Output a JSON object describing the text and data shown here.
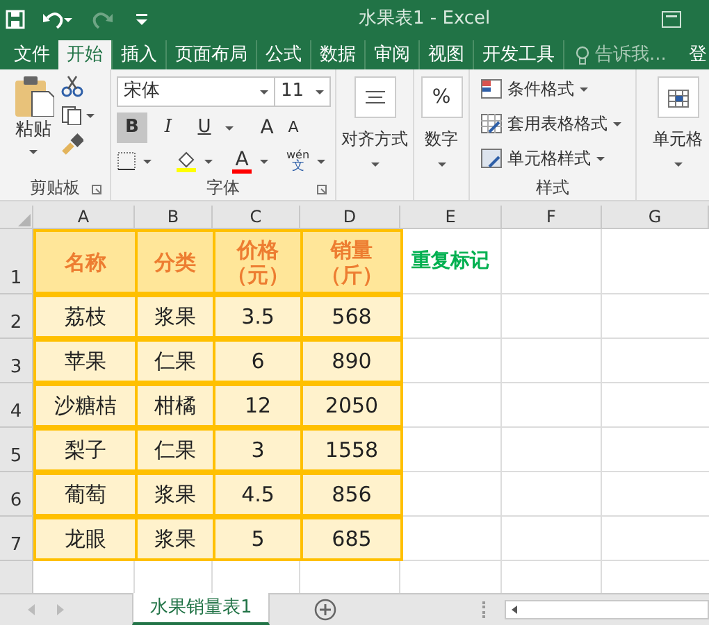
{
  "window": {
    "title": "水果表1 - Excel"
  },
  "tabs": [
    {
      "label": "文件",
      "selected": false
    },
    {
      "label": "开始",
      "selected": true
    },
    {
      "label": "插入",
      "selected": false
    },
    {
      "label": "页面布局",
      "selected": false
    },
    {
      "label": "公式",
      "selected": false
    },
    {
      "label": "数据",
      "selected": false
    },
    {
      "label": "审阅",
      "selected": false
    },
    {
      "label": "视图",
      "selected": false
    },
    {
      "label": "开发工具",
      "selected": false
    }
  ],
  "tell_me": {
    "placeholder": "告诉我..."
  },
  "account": "登",
  "ribbon": {
    "clipboard": {
      "paste": "粘贴",
      "label": "剪贴板"
    },
    "font": {
      "name": "宋体",
      "size": "11",
      "label": "字体",
      "format_buttons": [
        {
          "label": "B",
          "on": true
        },
        {
          "label": "I",
          "on": false
        },
        {
          "label": "U",
          "on": false
        }
      ],
      "grow": "A",
      "shrink": "A",
      "font_color": "A",
      "phonetic": {
        "top": "wén",
        "bottom": "文"
      }
    },
    "alignment": "对齐方式",
    "number": {
      "symbol": "%",
      "label": "数字"
    },
    "styles": {
      "items": [
        "条件格式",
        "套用表格格式",
        "单元格样式"
      ],
      "label": "样式"
    },
    "cells": "单元格"
  },
  "sheet": {
    "columns": [
      "A",
      "B",
      "C",
      "D",
      "E",
      "F",
      "G"
    ],
    "rows": [
      {
        "number": "1",
        "cells": [
          {
            "kind": "header",
            "lines": [
              "名称"
            ]
          },
          {
            "kind": "header",
            "lines": [
              "分类"
            ]
          },
          {
            "kind": "header",
            "lines": [
              "价格",
              "（元）"
            ]
          },
          {
            "kind": "header",
            "lines": [
              "销量",
              "（斤）"
            ]
          },
          {
            "kind": "note",
            "lines": [
              "重复标记"
            ]
          }
        ]
      },
      {
        "number": "2",
        "cells": [
          {
            "kind": "data",
            "lines": [
              "荔枝"
            ]
          },
          {
            "kind": "data",
            "lines": [
              "浆果"
            ]
          },
          {
            "kind": "data",
            "lines": [
              "3.5"
            ]
          },
          {
            "kind": "data",
            "lines": [
              "568"
            ]
          }
        ]
      },
      {
        "number": "3",
        "cells": [
          {
            "kind": "data",
            "lines": [
              "苹果"
            ]
          },
          {
            "kind": "data",
            "lines": [
              "仁果"
            ]
          },
          {
            "kind": "data",
            "lines": [
              "6"
            ]
          },
          {
            "kind": "data",
            "lines": [
              "890"
            ]
          }
        ]
      },
      {
        "number": "4",
        "cells": [
          {
            "kind": "data",
            "lines": [
              "沙糖桔"
            ]
          },
          {
            "kind": "data",
            "lines": [
              "柑橘"
            ]
          },
          {
            "kind": "data",
            "lines": [
              "12"
            ]
          },
          {
            "kind": "data",
            "lines": [
              "2050"
            ]
          }
        ]
      },
      {
        "number": "5",
        "cells": [
          {
            "kind": "data",
            "lines": [
              "梨子"
            ]
          },
          {
            "kind": "data",
            "lines": [
              "仁果"
            ]
          },
          {
            "kind": "data",
            "lines": [
              "3"
            ]
          },
          {
            "kind": "data",
            "lines": [
              "1558"
            ]
          }
        ]
      },
      {
        "number": "6",
        "cells": [
          {
            "kind": "data",
            "lines": [
              "葡萄"
            ]
          },
          {
            "kind": "data",
            "lines": [
              "浆果"
            ]
          },
          {
            "kind": "data",
            "lines": [
              "4.5"
            ]
          },
          {
            "kind": "data",
            "lines": [
              "856"
            ]
          }
        ]
      },
      {
        "number": "7",
        "cells": [
          {
            "kind": "data",
            "lines": [
              "龙眼"
            ]
          },
          {
            "kind": "data",
            "lines": [
              "浆果"
            ]
          },
          {
            "kind": "data",
            "lines": [
              "5"
            ]
          },
          {
            "kind": "data",
            "lines": [
              "685"
            ]
          }
        ]
      }
    ]
  },
  "sheet_tabs": [
    {
      "label": "水果销量表1",
      "selected": true
    }
  ]
}
